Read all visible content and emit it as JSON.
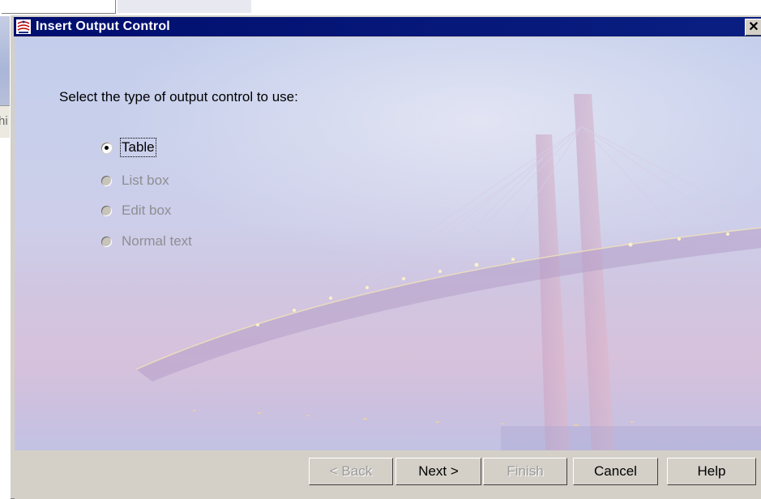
{
  "dialog": {
    "title": "Insert Output Control",
    "close_glyph": "✕",
    "icon": "app-icon"
  },
  "main": {
    "prompt": "Select the type of output control to use:",
    "options": [
      {
        "label": "Table",
        "selected": true,
        "enabled": true
      },
      {
        "label": "List box",
        "selected": false,
        "enabled": false
      },
      {
        "label": "Edit box",
        "selected": false,
        "enabled": false
      },
      {
        "label": "Normal text",
        "selected": false,
        "enabled": false
      }
    ]
  },
  "buttons": {
    "back": "< Back",
    "next": "Next >",
    "finish": "Finish",
    "cancel": "Cancel",
    "help": "Help"
  },
  "background_app": {
    "tab_fragment": "hi"
  },
  "colors": {
    "title_bar": "#0a1f82",
    "dialog_face": "#d4d0c8",
    "disabled_text": "#8e8e93"
  }
}
